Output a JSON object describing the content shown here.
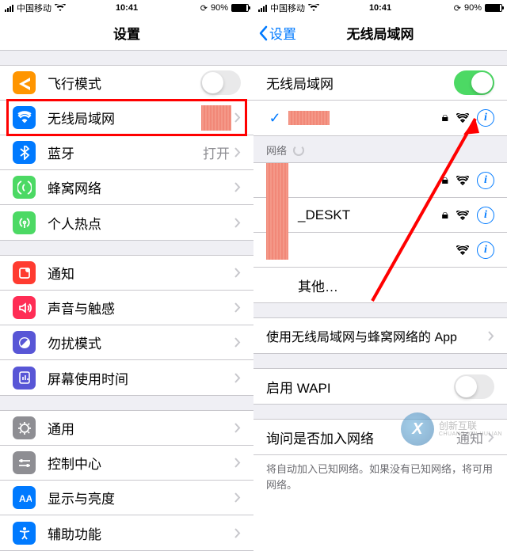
{
  "status": {
    "carrier": "中国移动",
    "time": "10:41",
    "battery": "90%"
  },
  "left": {
    "title": "设置",
    "rows": [
      {
        "key": "airplane",
        "label": "飞行模式",
        "toggle": "off",
        "iconBg": "#ff9500"
      },
      {
        "key": "wifi",
        "label": "无线局域网",
        "redacted": true,
        "highlight": true,
        "iconBg": "#007aff"
      },
      {
        "key": "bluetooth",
        "label": "蓝牙",
        "detail": "打开",
        "iconBg": "#007aff"
      },
      {
        "key": "cellular",
        "label": "蜂窝网络",
        "iconBg": "#4cd964"
      },
      {
        "key": "hotspot",
        "label": "个人热点",
        "iconBg": "#4cd964"
      }
    ],
    "rows2": [
      {
        "key": "notifications",
        "label": "通知",
        "iconBg": "#ff3b30"
      },
      {
        "key": "sounds",
        "label": "声音与触感",
        "iconBg": "#ff2d55"
      },
      {
        "key": "dnd",
        "label": "勿扰模式",
        "iconBg": "#5856d6"
      },
      {
        "key": "screentime",
        "label": "屏幕使用时间",
        "iconBg": "#5856d6"
      }
    ],
    "rows3": [
      {
        "key": "general",
        "label": "通用",
        "iconBg": "#8e8e93"
      },
      {
        "key": "control",
        "label": "控制中心",
        "iconBg": "#8e8e93"
      },
      {
        "key": "display",
        "label": "显示与亮度",
        "iconBg": "#007aff"
      },
      {
        "key": "accessibility",
        "label": "辅助功能",
        "iconBg": "#007aff"
      }
    ]
  },
  "right": {
    "back": "设置",
    "title": "无线局域网",
    "wifi_label": "无线局域网",
    "wifi_on": true,
    "networks_header": "网络",
    "networks": [
      {
        "name": "",
        "redacted": true,
        "lock": true
      },
      {
        "name": "_DESKT",
        "redacted": true,
        "lock": true
      },
      {
        "name": "",
        "redacted": true,
        "lock": false
      }
    ],
    "other": "其他…",
    "apps_row": "使用无线局域网与蜂窝网络的 App",
    "wapi_row": "启用 WAPI",
    "ask_row": "询问是否加入网络",
    "ask_detail": "通知",
    "ask_footnote": "将自动加入已知网络。如果没有已知网络，将可用网络。"
  },
  "watermark": {
    "brand": "创新互联",
    "domain": "CHUANG XIN HULIAN"
  }
}
